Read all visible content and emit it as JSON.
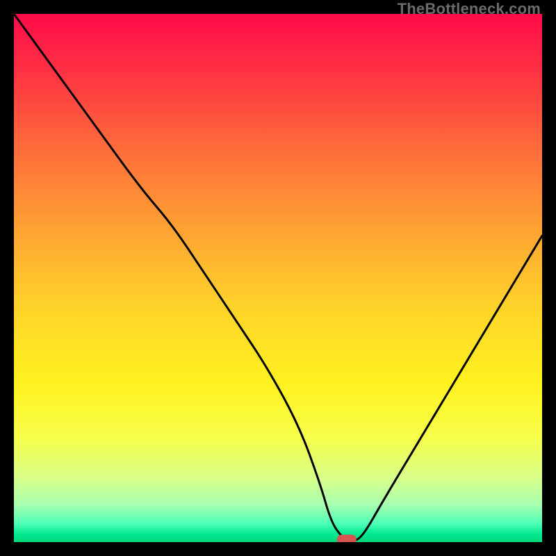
{
  "watermark": "TheBottleneck.com",
  "chart_data": {
    "type": "line",
    "title": "",
    "xlabel": "",
    "ylabel": "",
    "xlim": [
      0,
      100
    ],
    "ylim": [
      0,
      100
    ],
    "series": [
      {
        "name": "bottleneck-curve",
        "x": [
          0,
          8,
          16,
          24,
          30,
          36,
          42,
          48,
          54,
          58,
          60,
          62,
          64,
          66,
          70,
          76,
          82,
          88,
          94,
          100
        ],
        "values": [
          100,
          89,
          78,
          67,
          60,
          51,
          42,
          33,
          22,
          11,
          4,
          1,
          0,
          1,
          8,
          18,
          28,
          38,
          48,
          58
        ]
      }
    ],
    "marker": {
      "x": 63,
      "y": 0.5,
      "color": "#d9534f"
    },
    "gradient_stops": [
      {
        "offset": 0.0,
        "color": "#ff0b49"
      },
      {
        "offset": 0.1,
        "color": "#ff2e44"
      },
      {
        "offset": 0.25,
        "color": "#ff6a3b"
      },
      {
        "offset": 0.4,
        "color": "#ffa033"
      },
      {
        "offset": 0.55,
        "color": "#ffd22a"
      },
      {
        "offset": 0.7,
        "color": "#fff21f"
      },
      {
        "offset": 0.8,
        "color": "#f7ff4a"
      },
      {
        "offset": 0.88,
        "color": "#d8ff8a"
      },
      {
        "offset": 0.93,
        "color": "#a6ffb0"
      },
      {
        "offset": 0.965,
        "color": "#4dffb6"
      },
      {
        "offset": 0.985,
        "color": "#00e890"
      },
      {
        "offset": 1.0,
        "color": "#00d679"
      }
    ]
  }
}
